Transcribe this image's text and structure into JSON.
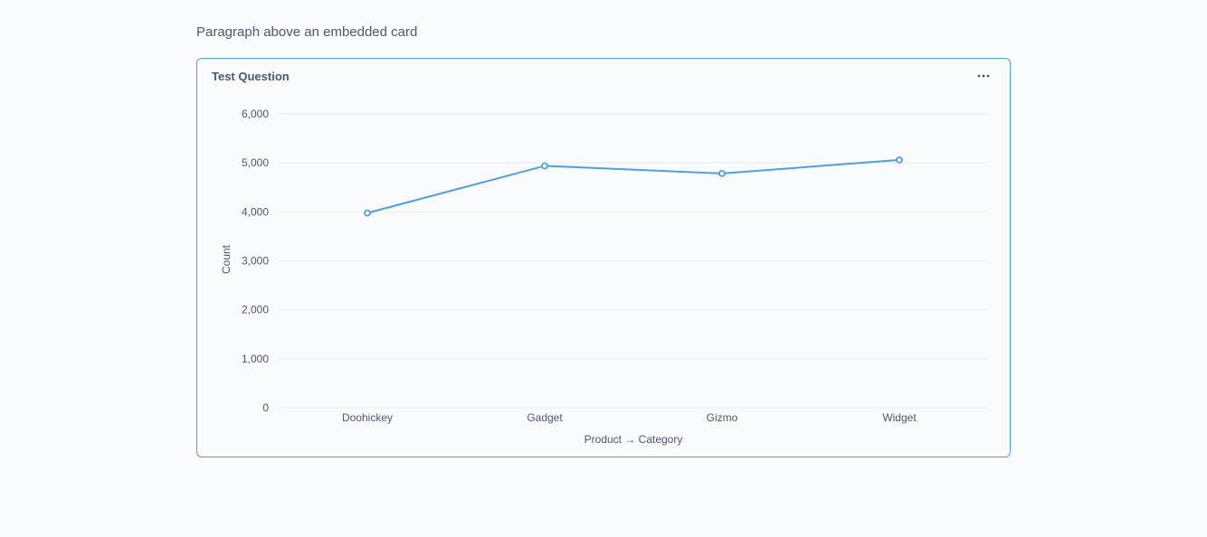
{
  "paragraph": {
    "text": "Paragraph above an embedded card"
  },
  "card": {
    "title": "Test Question",
    "menu_icon": "ellipsis-icon"
  },
  "colors": {
    "accent": "#509ee3",
    "text": "#4c5773",
    "grid": "#ebeef1"
  },
  "chart_data": {
    "type": "line",
    "categories": [
      "Doohickey",
      "Gadget",
      "Gizmo",
      "Widget"
    ],
    "values": [
      3976,
      4939,
      4784,
      5061
    ],
    "xlabel": "Product → Category",
    "ylabel": "Count",
    "ylim": [
      0,
      6000
    ],
    "yticks": [
      "0",
      "1,000",
      "2,000",
      "3,000",
      "4,000",
      "5,000",
      "6,000"
    ],
    "grid": true
  }
}
